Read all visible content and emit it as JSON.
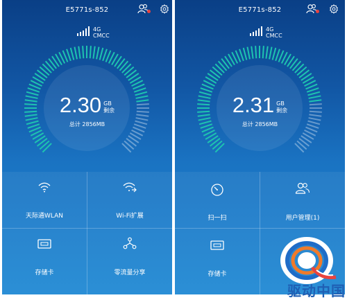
{
  "screens": [
    {
      "title": "E5771s-852",
      "network": {
        "gen": "4G",
        "carrier": "CMCC"
      },
      "usage": {
        "value": "2.30",
        "unit": "GB",
        "remaining_label": "剩余",
        "total_text": "总计 2856MB",
        "remaining_fraction": 0.81
      },
      "tiles": [
        {
          "label": "天际通WLAN",
          "icon": "wifi-icon"
        },
        {
          "label": "Wi-Fi扩展",
          "icon": "wifi-extend-icon"
        },
        {
          "label": "存储卡",
          "icon": "memory-card-icon"
        },
        {
          "label": "零流量分享",
          "icon": "share-icon"
        }
      ]
    },
    {
      "title": "E5771s-852",
      "network": {
        "gen": "4G",
        "carrier": "CMCC"
      },
      "usage": {
        "value": "2.31",
        "unit": "GB",
        "remaining_label": "剩余",
        "total_text": "总计 2856MB",
        "remaining_fraction": 0.81
      },
      "tiles": [
        {
          "label": "扫一扫",
          "icon": "scan-icon"
        },
        {
          "label": "用户管理(1)",
          "icon": "users-icon"
        },
        {
          "label": "存储卡",
          "icon": "memory-card-icon"
        }
      ]
    }
  ],
  "watermark": {
    "text": "驱动中国"
  },
  "colors": {
    "background": "#1257a5",
    "gauge_active": "#1ec3b0",
    "badge": "#e8433f",
    "watermark": "#1f5fb4"
  }
}
